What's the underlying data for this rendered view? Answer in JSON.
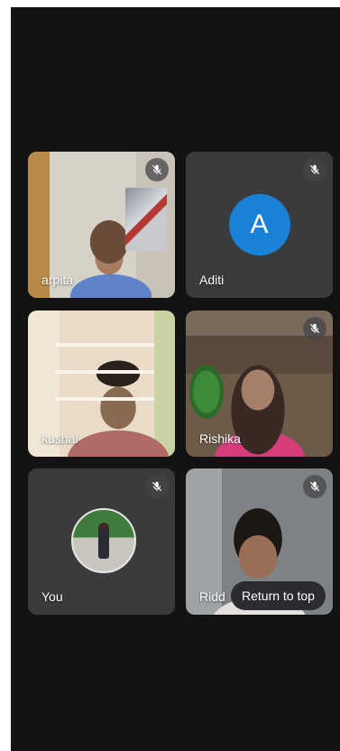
{
  "participants": [
    {
      "name": "arpita",
      "muted": true,
      "kind": "video"
    },
    {
      "name": "Aditi",
      "muted": true,
      "kind": "letter-avatar",
      "initial": "A",
      "avatar_color": "#1a82d6"
    },
    {
      "name": "kushal",
      "muted": false,
      "kind": "video"
    },
    {
      "name": "Rishika",
      "muted": true,
      "kind": "video"
    },
    {
      "name": "You",
      "muted": true,
      "kind": "photo-avatar"
    },
    {
      "name": "Ridd",
      "muted": true,
      "kind": "video"
    }
  ],
  "return_to_top": {
    "label": "Return to top"
  },
  "colors": {
    "background": "#131313",
    "tile": "#3a3b3d",
    "accent_avatar": "#1a82d6",
    "text": "#ffffff"
  },
  "icons": {
    "mute": "mic-off-icon"
  }
}
